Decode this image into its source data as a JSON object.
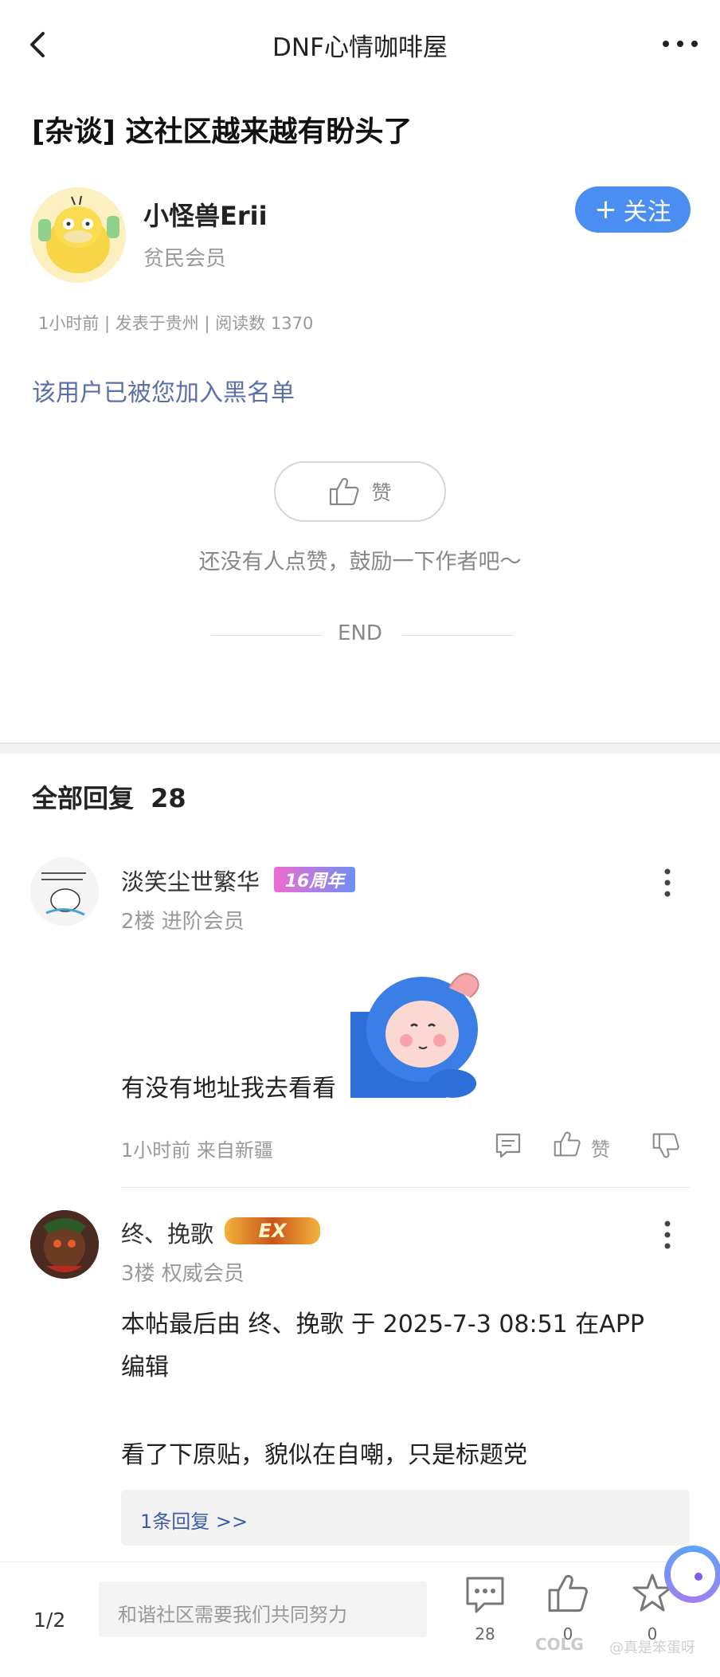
{
  "topbar": {
    "title": "DNF心情咖啡屋",
    "back_icon": "chevron-left-icon",
    "more_icon": "ellipsis-horizontal-icon"
  },
  "post": {
    "title": "[杂谈] 这社区越来越有盼头了",
    "author_name": "小怪兽Erii",
    "author_rank": "贫民会员",
    "follow_label": "关注",
    "meta": "1小时前 | 发表于贵州 | 阅读数 1370",
    "blacklist_note": "该用户已被您加入黑名单",
    "like_label": "赞",
    "like_hint": "还没有人点赞，鼓励一下作者吧～",
    "end_label": "END"
  },
  "replies": {
    "header_label": "全部回复",
    "count": "28",
    "items": [
      {
        "name": "淡笑尘世繁华",
        "badge": "16周年",
        "rank": "2楼 进阶会员",
        "text": "有没有地址我去看看",
        "meta": "1小时前 来自新疆",
        "like_label": "赞"
      },
      {
        "name": "终、挽歌",
        "badge": "EX",
        "rank": "3楼 权威会员",
        "text_line1": "本帖最后由 终、挽歌 于 2025-7-3 08:51 在APP",
        "text_line2": "编辑",
        "text_line3": "看了下原贴，貌似在自嘲，只是标题党",
        "sub_reply_link": "1条回复 >>"
      }
    ]
  },
  "bottombar": {
    "page_indicator": "1/2",
    "input_placeholder": "和谐社区需要我们共同努力",
    "comment_count": "28",
    "like_count": "0",
    "fav_count": "0"
  },
  "watermark": {
    "logo": "COLG",
    "handle": "@真是笨蛋呀"
  },
  "colors": {
    "accent": "#4b8ef1",
    "link": "#5b6fa8",
    "badge_16": "#e85ec8",
    "badge_ex": "#d9731f"
  }
}
